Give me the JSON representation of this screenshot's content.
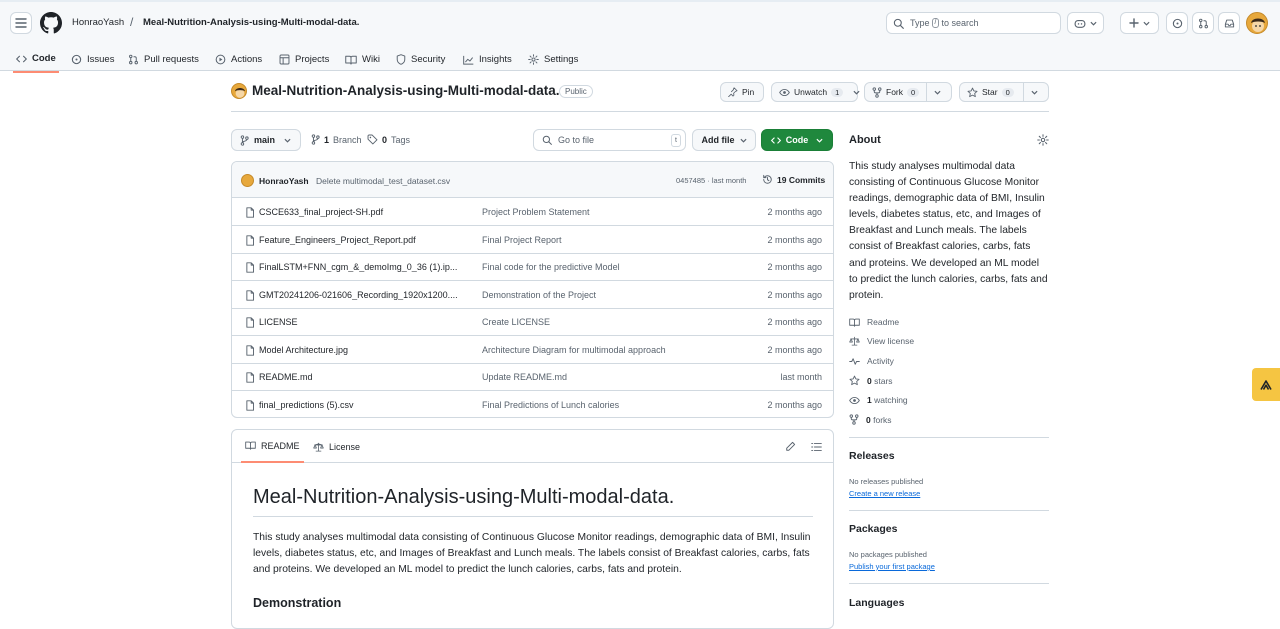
{
  "header": {
    "owner": "HonraoYash",
    "separator": "/",
    "repo": "Meal-Nutrition-Analysis-using-Multi-modal-data.",
    "search_prefix": "Type",
    "search_key": "/",
    "search_suffix": "to search"
  },
  "repo_nav": [
    {
      "label": "Code",
      "icon": "code-icon"
    },
    {
      "label": "Issues",
      "icon": "issue-icon"
    },
    {
      "label": "Pull requests",
      "icon": "pull-request-icon"
    },
    {
      "label": "Actions",
      "icon": "play-icon"
    },
    {
      "label": "Projects",
      "icon": "table-icon"
    },
    {
      "label": "Wiki",
      "icon": "book-icon"
    },
    {
      "label": "Security",
      "icon": "shield-icon"
    },
    {
      "label": "Insights",
      "icon": "graph-icon"
    },
    {
      "label": "Settings",
      "icon": "gear-icon"
    }
  ],
  "repo_head": {
    "name": "Meal-Nutrition-Analysis-using-Multi-modal-data.",
    "visibility": "Public",
    "pin_label": "Pin",
    "watch_label": "Unwatch",
    "watch_count": "1",
    "fork_label": "Fork",
    "fork_count": "0",
    "star_label": "Star",
    "star_count": "0"
  },
  "toolbar": {
    "branch": "main",
    "branches_count": "1",
    "branches_label": "Branch",
    "tags_count": "0",
    "tags_label": "Tags",
    "goto_placeholder": "Go to file",
    "goto_key": "t",
    "add_file": "Add file",
    "code": "Code"
  },
  "latest_commit": {
    "author": "HonraoYash",
    "message": "Delete multimodal_test_dataset.csv",
    "sha_age": "0457485 · last month",
    "count_label": "19 Commits"
  },
  "files": [
    {
      "name": "CSCE633_final_project-SH.pdf",
      "commit": "Project Problem Statement",
      "age": "2 months ago"
    },
    {
      "name": "Feature_Engineers_Project_Report.pdf",
      "commit": "Final Project Report",
      "age": "2 months ago"
    },
    {
      "name": "FinalLSTM+FNN_cgm_&_demoImg_0_36 (1).ip...",
      "commit": "Final code for the predictive Model",
      "age": "2 months ago"
    },
    {
      "name": "GMT20241206-021606_Recording_1920x1200....",
      "commit": "Demonstration of the Project",
      "age": "2 months ago"
    },
    {
      "name": "LICENSE",
      "commit": "Create LICENSE",
      "age": "2 months ago"
    },
    {
      "name": "Model Architecture.jpg",
      "commit": "Architecture Diagram for multimodal approach",
      "age": "2 months ago"
    },
    {
      "name": "README.md",
      "commit": "Update README.md",
      "age": "last month"
    },
    {
      "name": "final_predictions (5).csv",
      "commit": "Final Predictions of Lunch calories",
      "age": "2 months ago"
    }
  ],
  "readme": {
    "tab_readme": "README",
    "tab_license": "License",
    "title": "Meal-Nutrition-Analysis-using-Multi-modal-data.",
    "paragraph": "This study analyses multimodal data consisting of Continuous Glucose Monitor readings, demographic data of BMI, Insulin levels, diabetes status, etc, and Images of Breakfast and Lunch meals. The labels consist of Breakfast calories, carbs, fats and proteins. We developed an ML model to predict the lunch calories, carbs, fats and protein.",
    "section": "Demonstration"
  },
  "sidebar": {
    "about_title": "About",
    "description": "This study analyses multimodal data consisting of Continuous Glucose Monitor readings, demographic data of BMI, Insulin levels, diabetes status, etc, and Images of Breakfast and Lunch meals. The labels consist of Breakfast calories, carbs, fats and proteins. We developed an ML model to predict the lunch calories, carbs, fats and protein.",
    "readme_link": "Readme",
    "license_link": "View license",
    "activity_link": "Activity",
    "stars_count": "0",
    "stars_label": "stars",
    "watching_count": "1",
    "watching_label": "watching",
    "forks_count": "0",
    "forks_label": "forks",
    "releases_title": "Releases",
    "releases_none": "No releases published",
    "releases_create": "Create a new release",
    "packages_title": "Packages",
    "packages_none": "No packages published",
    "packages_publish": "Publish your first package",
    "languages_title": "Languages"
  },
  "colors": {
    "accent": "#1f883d",
    "link": "#0969da",
    "tab_underline": "#fd8c73",
    "extension": "#f5c542"
  }
}
